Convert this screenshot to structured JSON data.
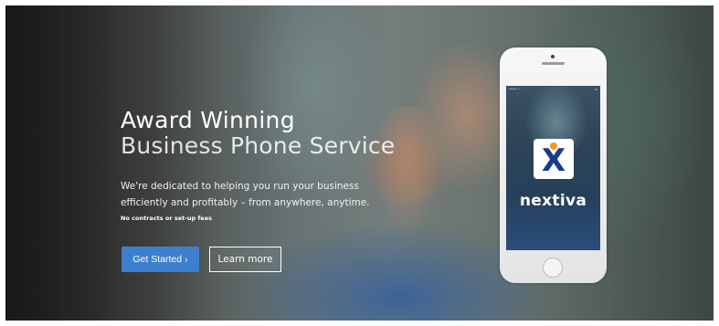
{
  "hero": {
    "title_line1": "Award Winning",
    "title_line2": "Business Phone Service",
    "description": "We're dedicated to helping you run your business efficiently and profitably – from anywhere, anytime.",
    "fine_print": "No contracts or set-up fees",
    "primary_button": {
      "label": "Get Started",
      "icon": "chevron-right-icon"
    },
    "secondary_button": {
      "label": "Learn more"
    }
  },
  "phone": {
    "brand_name": "nextiva",
    "logo_letter": "X"
  },
  "colors": {
    "primary_button": "#3d7fcf",
    "logo_dot": "#f39a1b",
    "logo_letter": "#1d3a8a"
  }
}
